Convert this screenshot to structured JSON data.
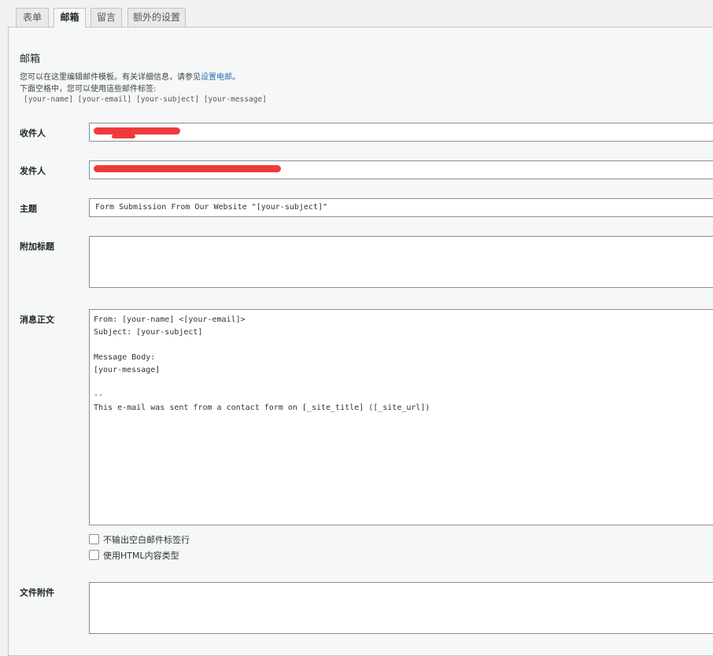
{
  "tabs": [
    {
      "label": "表单"
    },
    {
      "label": "邮箱"
    },
    {
      "label": "留言"
    },
    {
      "label": "额外的设置"
    }
  ],
  "mail": {
    "title": "邮箱",
    "desc_line1_prefix": "您可以在这里编辑邮件模板。有关详细信息，请参见",
    "desc_link": "设置电邮",
    "desc_line1_suffix": "。",
    "desc_line2": "下面空格中，您可以使用這些邮件标签:",
    "tags": "[your-name] [your-email] [your-subject] [your-message]"
  },
  "fields": {
    "to": {
      "label": "收件人",
      "value": ""
    },
    "from": {
      "label": "发件人",
      "value": ""
    },
    "subject": {
      "label": "主题",
      "value": "Form Submission From Our Website \"[your-subject]\""
    },
    "headers": {
      "label": "附加标题",
      "value": ""
    },
    "body": {
      "label": "消息正文",
      "value": "From: [your-name] <[your-email]>\nSubject: [your-subject]\n\nMessage Body:\n[your-message]\n\n--\nThis e-mail was sent from a contact form on [_site_title] ([_site_url])"
    },
    "attachments": {
      "label": "文件附件",
      "value": ""
    }
  },
  "options": {
    "exclude_blank": {
      "label": "不输出空白邮件标签行",
      "checked": false
    },
    "use_html": {
      "label": "使用HTML内容类型",
      "checked": false
    }
  },
  "colors": {
    "redaction": "#f03a3a",
    "link": "#2271b1"
  }
}
